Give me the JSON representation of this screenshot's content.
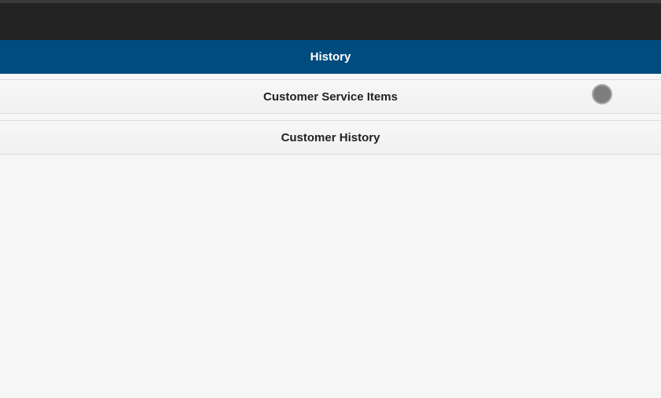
{
  "header": {
    "title": "History"
  },
  "menu": {
    "items": [
      {
        "label": "Customer Service Items"
      },
      {
        "label": "Customer History"
      }
    ]
  },
  "colors": {
    "header_bg": "#004c7e",
    "top_bar_bg": "#232323",
    "page_bg": "#f6f6f6"
  }
}
